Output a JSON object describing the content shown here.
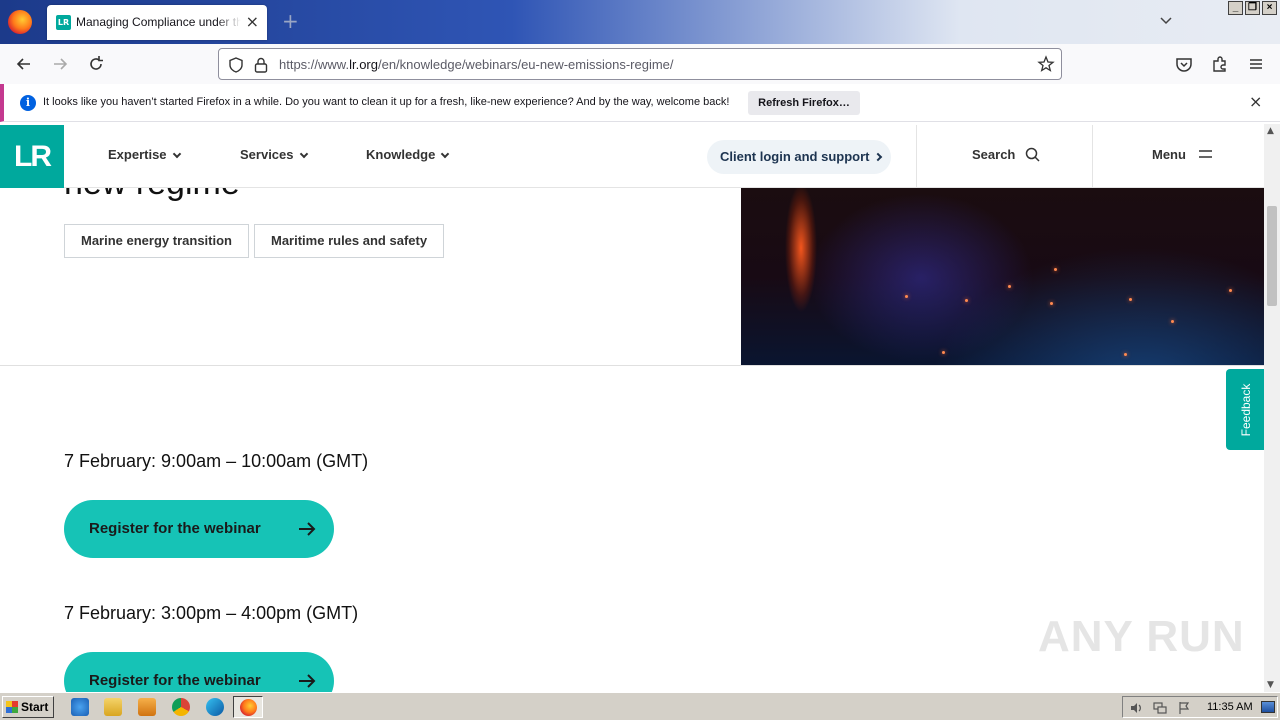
{
  "browser": {
    "tab_title": "Managing Compliance under the EU",
    "tab_favicon_text": "LR",
    "url_prefix": "https://www.",
    "url_domain": "lr.org",
    "url_path": "/en/knowledge/webinars/eu-new-emissions-regime/",
    "notice_text": "It looks like you haven’t started Firefox in a while. Do you want to clean it up for a fresh, like-new experience? And by the way, welcome back!",
    "notice_button": "Refresh Firefox…"
  },
  "site": {
    "logo_text": "LR",
    "brand_color": "#00a99d",
    "nav": [
      {
        "label": "Expertise"
      },
      {
        "label": "Services"
      },
      {
        "label": "Knowledge"
      }
    ],
    "client_button": "Client login and support",
    "search_label": "Search",
    "menu_label": "Menu",
    "hero_title_fragment": "new regime",
    "tags": [
      "Marine energy transition",
      "Maritime rules and safety"
    ],
    "sessions": [
      {
        "time": "7 February: 9:00am – 10:00am (GMT)",
        "button": "Register for the webinar"
      },
      {
        "time": "7 February: 3:00pm – 4:00pm (GMT)",
        "button": "Register for the webinar"
      }
    ],
    "feedback_label": "Feedback",
    "watermark": "ANY RUN"
  },
  "taskbar": {
    "start_label": "Start",
    "clock": "11:35 AM"
  }
}
